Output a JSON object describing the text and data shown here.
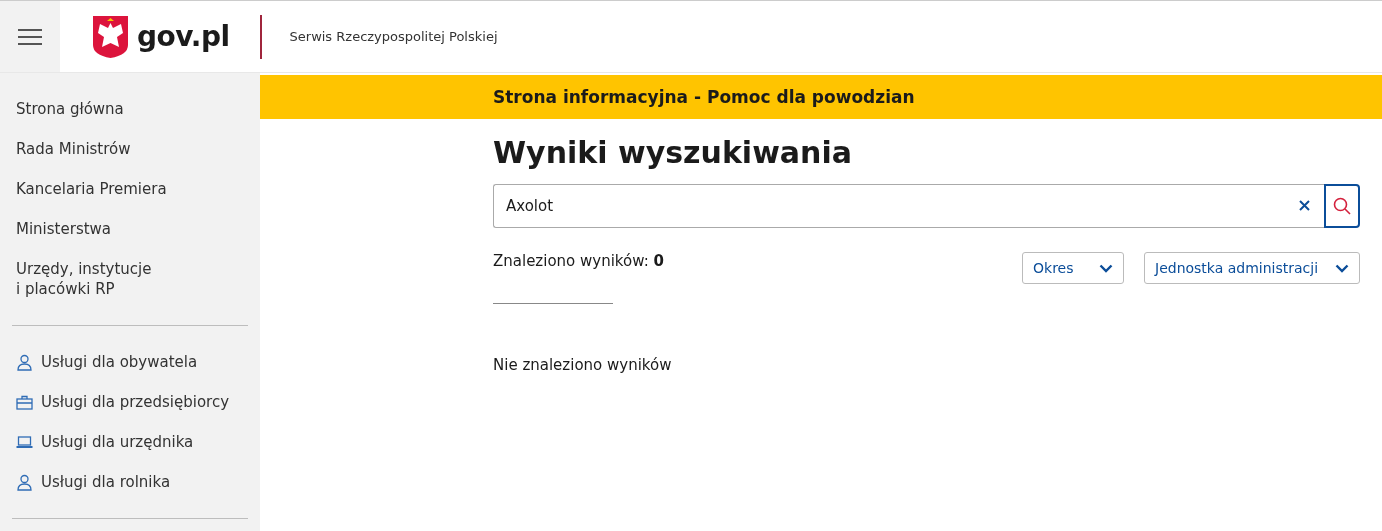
{
  "header": {
    "logo_text": "gov.pl",
    "tagline": "Serwis Rzeczypospolitej Polskiej"
  },
  "sidebar": {
    "items": [
      {
        "label": "Strona główna"
      },
      {
        "label": "Rada Ministrów"
      },
      {
        "label": "Kancelaria Premiera"
      },
      {
        "label": "Ministerstwa"
      },
      {
        "label": "Urzędy, instytucje\ni placówki RP"
      }
    ],
    "services": [
      {
        "kind": "person",
        "label": "Usługi dla obywatela"
      },
      {
        "kind": "briefcase",
        "label": "Usługi dla przedsiębiorcy"
      },
      {
        "kind": "laptop",
        "label": "Usługi dla urzędnika"
      },
      {
        "kind": "person",
        "label": "Usługi dla rolnika"
      }
    ]
  },
  "banner": "Strona informacyjna - Pomoc dla powodzian",
  "heading": "Wyniki wyszukiwania",
  "search": {
    "value": "Axolot"
  },
  "results": {
    "label": "Znaleziono wyników: ",
    "count": "0",
    "message": "Nie znaleziono wyników"
  },
  "filters": [
    {
      "label": "Okres"
    },
    {
      "label": "Jednostka administracji"
    }
  ]
}
